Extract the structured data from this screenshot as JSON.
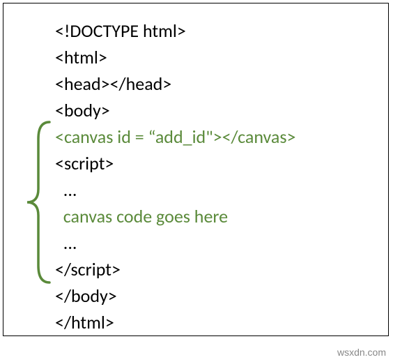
{
  "code": {
    "l1": "<!DOCTYPE html>",
    "l2": "<html>",
    "l3": "<head></head>",
    "l4": "<body>",
    "l5": "<canvas id = “add_id\"></canvas>",
    "l6": "<script>",
    "l7": "  ...",
    "l8": "  canvas code goes here",
    "l9": "  ...",
    "l10": "</script>",
    "l11": "</body>",
    "l12": "</html>"
  },
  "watermark": "wsxdn.com",
  "brace_color": "#5a8a3a"
}
